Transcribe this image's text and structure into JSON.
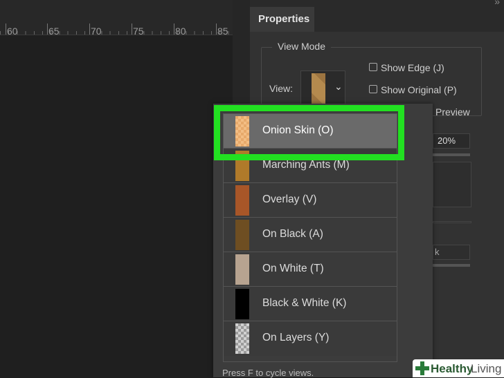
{
  "ruler": {
    "labels": [
      "60",
      "65",
      "70",
      "75",
      "80",
      "85"
    ]
  },
  "panel": {
    "tab_label": "Properties",
    "collapse_glyph": "»",
    "view_mode_title": "View Mode",
    "view_label": "View:",
    "show_edge_label": "Show Edge (J)",
    "show_original_label": "Show Original (P)",
    "preview_label": "Preview",
    "opacity_value": "20%",
    "ghost_field_text": "k"
  },
  "dropdown": {
    "items": [
      {
        "label": "Onion Skin (O)",
        "swatch_color": "#e7a96a",
        "selected": true
      },
      {
        "label": "Marching Ants (M)",
        "swatch_color": "#b07a2a"
      },
      {
        "label": "Overlay (V)",
        "swatch_color": "#a85628"
      },
      {
        "label": "On Black (A)",
        "swatch_color": "#6e4e22"
      },
      {
        "label": "On White (T)",
        "swatch_color": "#b7a390"
      },
      {
        "label": "Black & White (K)",
        "swatch_color": "#000000"
      },
      {
        "label": "On Layers (Y)",
        "swatch_color": "checker"
      }
    ],
    "footer_hint": "Press F to cycle views."
  },
  "watermark": {
    "bold": "Healthy",
    "regular": "Living"
  },
  "colors": {
    "highlight": "#22e021",
    "selected_row": "#6a6a6a"
  }
}
